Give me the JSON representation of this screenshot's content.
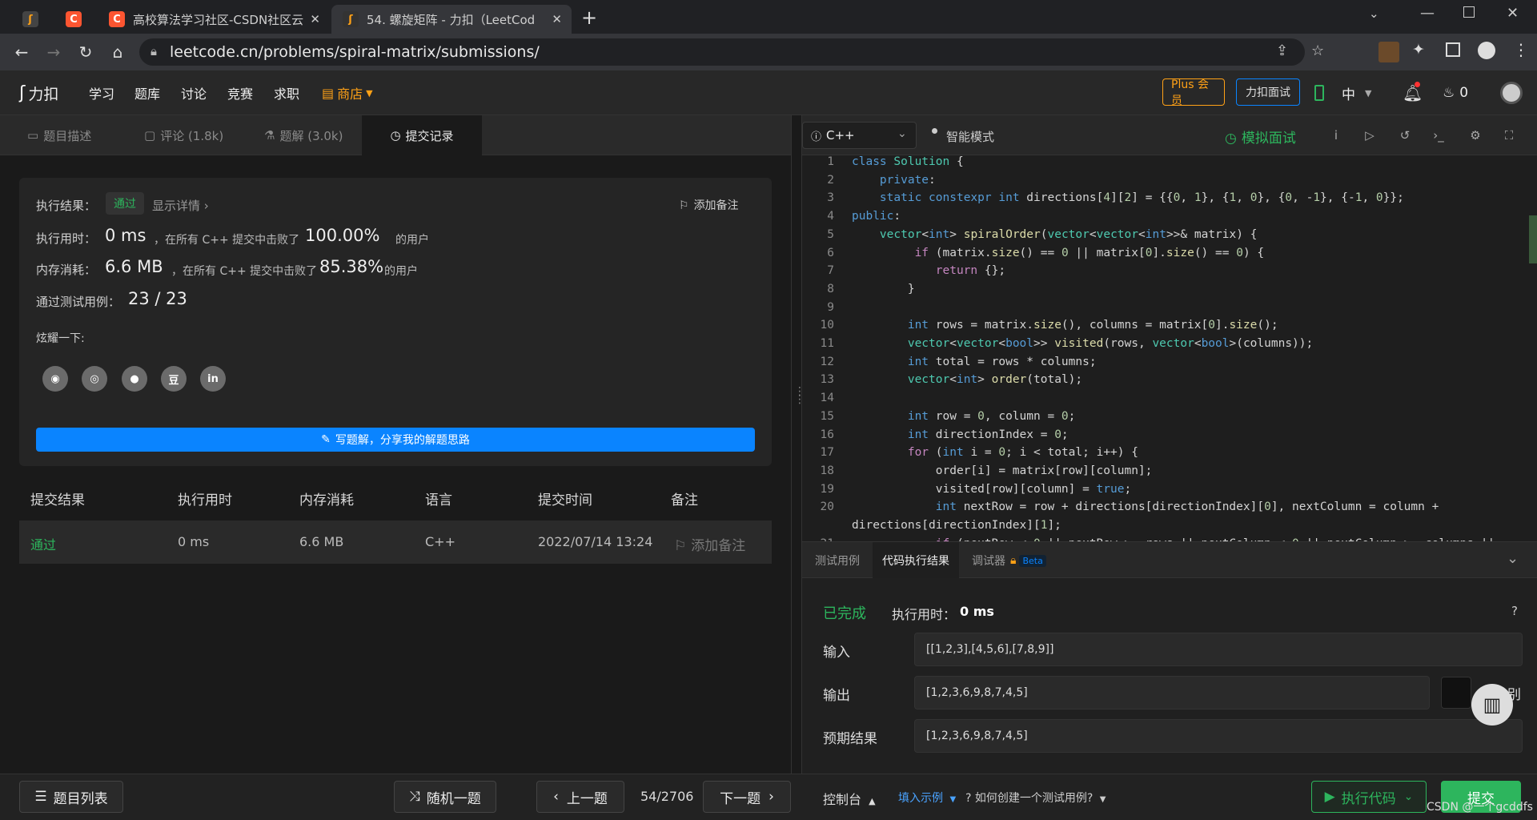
{
  "browser": {
    "tabs": [
      {
        "label": "",
        "favicon": "pinned-favicon"
      },
      {
        "label": "",
        "favicon": "csdn-favicon"
      },
      {
        "label": "高校算法学习社区-CSDN社区云",
        "favicon": "csdn-favicon"
      },
      {
        "label": "54. 螺旋矩阵 - 力扣（LeetCode）",
        "favicon": "leetcode-favicon"
      }
    ],
    "url": "leetcode.cn/problems/spiral-matrix/submissions/",
    "new_tab_icon": "plus-icon"
  },
  "lc_nav": {
    "logo": "力扣",
    "items": [
      "学习",
      "题库",
      "讨论",
      "竞赛",
      "求职"
    ],
    "store": "商店",
    "plus": "Plus 会员",
    "interview": "力扣面试",
    "lang": "中",
    "points": "0"
  },
  "left_tabs": {
    "desc": "题目描述",
    "comments": "评论 (1.8k)",
    "solutions": "题解 (3.0k)",
    "submissions": "提交记录"
  },
  "result": {
    "status_label": "执行结果：",
    "status": "通过",
    "details": "显示详情 ›",
    "add_note": "添加备注",
    "time_label": "执行用时：",
    "time_value": "0 ms",
    "time_text": "，在所有 C++ 提交中击败了",
    "time_pct": "100.00%",
    "time_suffix": "的用户",
    "mem_label": "内存消耗：",
    "mem_value": "6.6 MB",
    "mem_text": "，在所有 C++ 提交中击败了",
    "mem_pct": "85.38%",
    "mem_suffix": "的用户",
    "cases_label": "通过测试用例：",
    "cases_value": "23 / 23",
    "share_label": "炫耀一下:",
    "write_solution": "写题解，分享我的解题思路"
  },
  "submissions": {
    "headers": [
      "提交结果",
      "执行用时",
      "内存消耗",
      "语言",
      "提交时间",
      "备注"
    ],
    "rows": [
      {
        "result": "通过",
        "time": "0 ms",
        "memory": "6.6 MB",
        "language": "C++",
        "submitted": "2022/07/14 13:24",
        "note": "添加备注"
      }
    ]
  },
  "bottom": {
    "problem_list": "题目列表",
    "random": "随机一题",
    "prev": "上一题",
    "page": "54/2706",
    "next": "下一题",
    "console": "控制台",
    "fill_example": "填入示例",
    "how_create": "如何创建一个测试用例?",
    "run": "执行代码",
    "submit": "提交"
  },
  "editor": {
    "language": "C++",
    "mode": "智能模式",
    "mock": "模拟面试",
    "lines": [
      "1",
      "2",
      "3",
      "4",
      "5",
      "6",
      "7",
      "8",
      "9",
      "10",
      "11",
      "12",
      "13",
      "14",
      "15",
      "16",
      "17",
      "18",
      "19",
      "20",
      "",
      "21"
    ]
  },
  "console": {
    "tabs": [
      "测试用例",
      "代码执行结果",
      "调试器"
    ],
    "beta": "Beta",
    "status": "已完成",
    "time_label": "执行用时：",
    "time_value": "0 ms",
    "input_label": "输入",
    "input_value": "[[1,2,3],[4,5,6],[7,8,9]]",
    "output_label": "输出",
    "output_value": "[1,2,3,6,9,8,7,4,5]",
    "diff": "差别",
    "expected_label": "预期结果",
    "expected_value": "[1,2,3,6,9,8,7,4,5]",
    "watermark": "CSDN @一个gcddfs"
  },
  "colors": {
    "accent_green": "#2db55d",
    "accent_blue": "#0a84ff",
    "plus_orange": "#ffa116"
  }
}
